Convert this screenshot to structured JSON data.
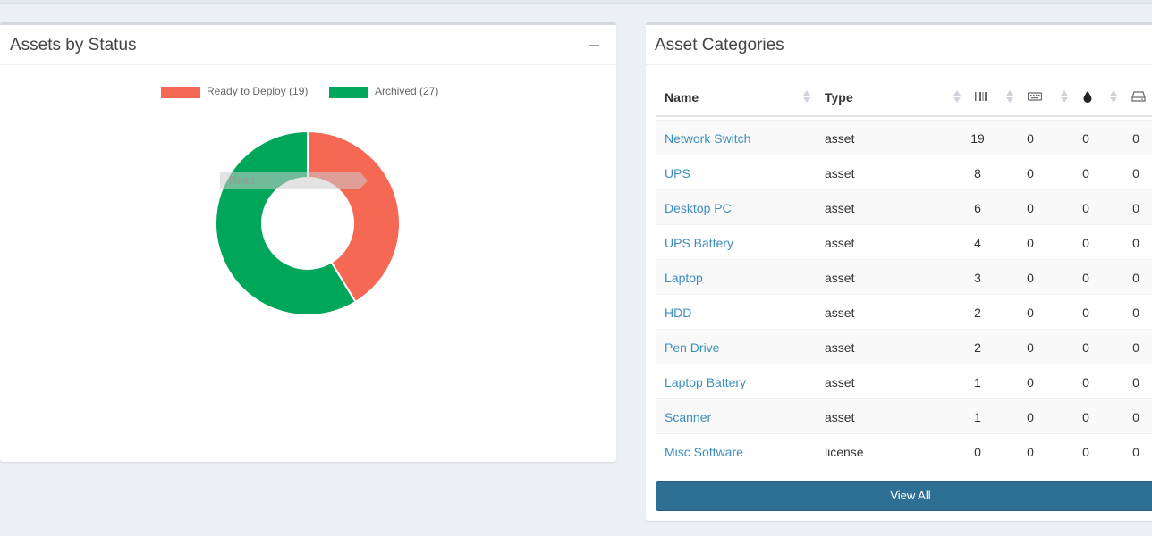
{
  "left_panel": {
    "title": "Assets by Status",
    "collapse_icon": "minus-icon"
  },
  "chart_data": {
    "type": "pie",
    "categories": [
      "Ready to Deploy (19)",
      "Archived (27)"
    ],
    "values": [
      19,
      27
    ],
    "colors": [
      "#f56954",
      "#00a65a"
    ],
    "title": "",
    "legend": "top",
    "tooltip_fragment": "Read"
  },
  "right_panel": {
    "title": "Asset Categories",
    "columns": {
      "name": "Name",
      "type": "Type",
      "icons": [
        "barcode-icon",
        "keyboard-icon",
        "tint-icon",
        "hdd-icon"
      ]
    },
    "rows": [
      {
        "name": "Network Switch",
        "type": "asset",
        "c1": "19",
        "c2": "0",
        "c3": "0",
        "c4": "0"
      },
      {
        "name": "UPS",
        "type": "asset",
        "c1": "8",
        "c2": "0",
        "c3": "0",
        "c4": "0"
      },
      {
        "name": "Desktop PC",
        "type": "asset",
        "c1": "6",
        "c2": "0",
        "c3": "0",
        "c4": "0"
      },
      {
        "name": "UPS Battery",
        "type": "asset",
        "c1": "4",
        "c2": "0",
        "c3": "0",
        "c4": "0"
      },
      {
        "name": "Laptop",
        "type": "asset",
        "c1": "3",
        "c2": "0",
        "c3": "0",
        "c4": "0"
      },
      {
        "name": "HDD",
        "type": "asset",
        "c1": "2",
        "c2": "0",
        "c3": "0",
        "c4": "0"
      },
      {
        "name": "Pen Drive",
        "type": "asset",
        "c1": "2",
        "c2": "0",
        "c3": "0",
        "c4": "0"
      },
      {
        "name": "Laptop Battery",
        "type": "asset",
        "c1": "1",
        "c2": "0",
        "c3": "0",
        "c4": "0"
      },
      {
        "name": "Scanner",
        "type": "asset",
        "c1": "1",
        "c2": "0",
        "c3": "0",
        "c4": "0"
      },
      {
        "name": "Misc Software",
        "type": "license",
        "c1": "0",
        "c2": "0",
        "c3": "0",
        "c4": "0"
      }
    ],
    "view_all_label": "View All"
  }
}
